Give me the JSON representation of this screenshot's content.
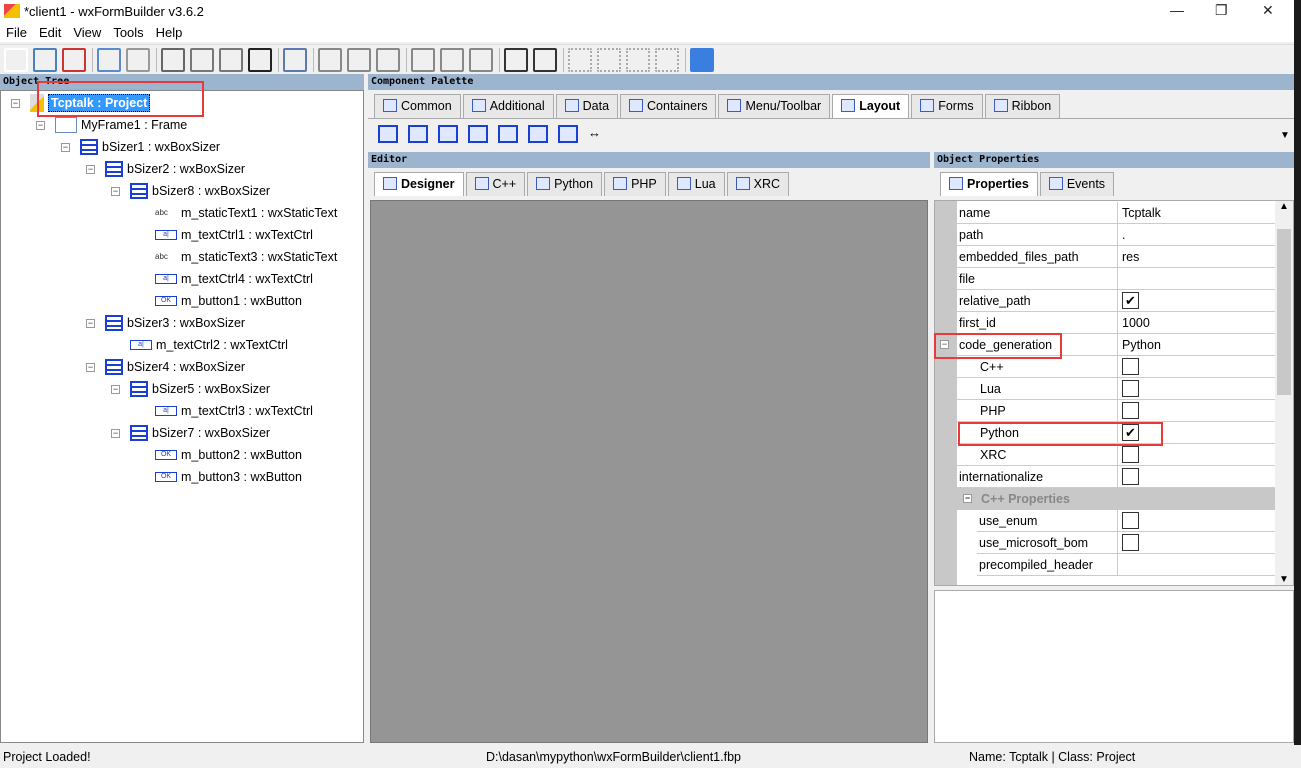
{
  "window": {
    "title": "*client1 - wxFormBuilder v3.6.2",
    "controls": [
      "minimize-icon",
      "maximize-icon",
      "close-icon"
    ]
  },
  "menu": [
    "File",
    "Edit",
    "View",
    "Tools",
    "Help"
  ],
  "toolbar": [
    "new-icon",
    "open-icon",
    "save-icon",
    "undo-icon",
    "redo-icon",
    "cut-icon",
    "copy-icon",
    "paste-icon",
    "delete-icon",
    "generate-code-icon",
    "align-left-icon",
    "align-center-h-icon",
    "align-right-icon",
    "align-top-icon",
    "align-center-v-icon",
    "align-bottom-icon",
    "expand-icon",
    "stretch-icon",
    "border-left-icon",
    "border-right-icon",
    "border-top-icon",
    "border-bottom-icon",
    "swap-icon"
  ],
  "object_tree": {
    "title": "Object Tree",
    "items": [
      {
        "label": "Tcptalk : Project",
        "level": 0,
        "icon": "proj",
        "selected": true
      },
      {
        "label": "MyFrame1 : Frame",
        "level": 1,
        "icon": "frame"
      },
      {
        "label": "bSizer1 : wxBoxSizer",
        "level": 2,
        "icon": "sizer"
      },
      {
        "label": "bSizer2 : wxBoxSizer",
        "level": 3,
        "icon": "sizer"
      },
      {
        "label": "bSizer8 : wxBoxSizer",
        "level": 4,
        "icon": "sizer"
      },
      {
        "label": "m_staticText1 : wxStaticText",
        "level": 5,
        "icon": "abc"
      },
      {
        "label": "m_textCtrl1 : wxTextCtrl",
        "level": 5,
        "icon": "text"
      },
      {
        "label": "m_staticText3 : wxStaticText",
        "level": 5,
        "icon": "abc"
      },
      {
        "label": "m_textCtrl4 : wxTextCtrl",
        "level": 5,
        "icon": "text"
      },
      {
        "label": "m_button1 : wxButton",
        "level": 5,
        "icon": "ok"
      },
      {
        "label": "bSizer3 : wxBoxSizer",
        "level": 3,
        "icon": "sizer"
      },
      {
        "label": "m_textCtrl2 : wxTextCtrl",
        "level": 4,
        "icon": "text"
      },
      {
        "label": "bSizer4 : wxBoxSizer",
        "level": 3,
        "icon": "sizer"
      },
      {
        "label": "bSizer5 : wxBoxSizer",
        "level": 4,
        "icon": "sizer"
      },
      {
        "label": "m_textCtrl3 : wxTextCtrl",
        "level": 5,
        "icon": "text"
      },
      {
        "label": "bSizer7 : wxBoxSizer",
        "level": 4,
        "icon": "sizer"
      },
      {
        "label": "m_button2 : wxButton",
        "level": 5,
        "icon": "ok"
      },
      {
        "label": "m_button3 : wxButton",
        "level": 5,
        "icon": "ok"
      }
    ]
  },
  "palette": {
    "title": "Component Palette",
    "tabs": [
      "Common",
      "Additional",
      "Data",
      "Containers",
      "Menu/Toolbar",
      "Layout",
      "Forms",
      "Ribbon"
    ],
    "active_tab": "Layout",
    "items": [
      "box-sizer-icon",
      "static-box-sizer-icon",
      "wrap-sizer-icon",
      "grid-sizer-icon",
      "flex-grid-sizer-icon",
      "grid-bag-sizer-icon",
      "std-dialog-button-sizer-icon",
      "spacer-icon"
    ]
  },
  "editor": {
    "title": "Editor",
    "tabs": [
      "Designer",
      "C++",
      "Python",
      "PHP",
      "Lua",
      "XRC"
    ],
    "active_tab": "Designer"
  },
  "properties": {
    "title": "Object Properties",
    "tabs": [
      "Properties",
      "Events"
    ],
    "active_tab": "Properties",
    "rows": [
      {
        "name": "name",
        "value": "Tcptalk"
      },
      {
        "name": "path",
        "value": "."
      },
      {
        "name": "embedded_files_path",
        "value": "res"
      },
      {
        "name": "file",
        "value": ""
      },
      {
        "name": "relative_path",
        "checked": true
      },
      {
        "name": "first_id",
        "value": "1000"
      },
      {
        "name": "code_generation",
        "value": "Python",
        "expander": true
      },
      {
        "name": "C++",
        "checked": false,
        "sub": true
      },
      {
        "name": "Lua",
        "checked": false,
        "sub": true
      },
      {
        "name": "PHP",
        "checked": false,
        "sub": true
      },
      {
        "name": "Python",
        "checked": true,
        "sub": true
      },
      {
        "name": "XRC",
        "checked": false,
        "sub": true
      },
      {
        "name": "internationalize",
        "checked": false
      },
      {
        "category": "C++ Properties"
      },
      {
        "name": "use_enum",
        "checked": false,
        "sub": true
      },
      {
        "name": "use_microsoft_bom",
        "checked": false,
        "sub": true
      },
      {
        "name": "precompiled_header",
        "value": "",
        "sub": true
      }
    ]
  },
  "status": {
    "message": "Project Loaded!",
    "file": "D:\\dasan\\mypython\\wxFormBuilder\\client1.fbp",
    "selection": "Name: Tcptalk | Class: Project"
  },
  "colors": {
    "panel_header": "#9db4cf",
    "selection": "#3399ff",
    "highlight_box": "#e83a3a",
    "canvas": "#959595"
  }
}
